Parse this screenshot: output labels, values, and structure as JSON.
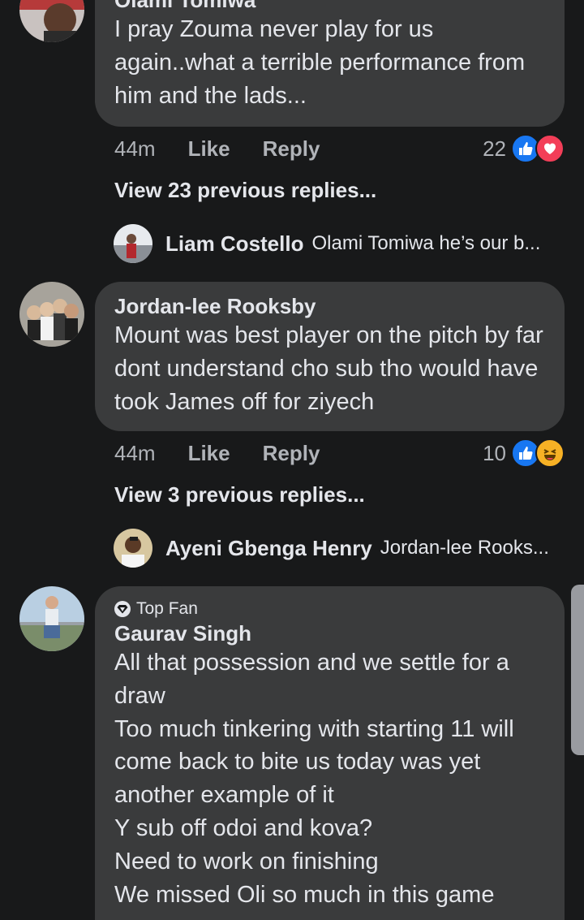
{
  "comments": [
    {
      "author": "Olami Tomiwa",
      "text": "I pray Zouma never play for us again..what a terrible performance from him and the lads...",
      "time": "44m",
      "like_label": "Like",
      "reply_label": "Reply",
      "reaction_count": "22",
      "reactions": [
        "like-icon",
        "love-icon"
      ],
      "view_previous": "View 23 previous replies...",
      "latest_reply": {
        "author": "Liam Costello",
        "text": "Olami Tomiwa  he’s our b..."
      }
    },
    {
      "author": "Jordan-lee Rooksby",
      "text": "Mount was best player on the pitch by far dont understand cho sub tho would have took James off for ziyech",
      "time": "44m",
      "like_label": "Like",
      "reply_label": "Reply",
      "reaction_count": "10",
      "reactions": [
        "like-icon",
        "haha-icon"
      ],
      "view_previous": "View 3 previous replies...",
      "latest_reply": {
        "author": "Ayeni Gbenga Henry",
        "text": "Jordan-lee Rooks..."
      }
    },
    {
      "badge": "Top Fan",
      "author": "Gaurav Singh",
      "text": "All that possession and we settle for a draw\nToo much tinkering with starting 11 will come back to bite us today was yet another example of it\nY sub off odoi and kova?\nNeed to work on finishing\nWe missed Oli so much in this game"
    }
  ],
  "colors": {
    "background": "#18191a",
    "bubble": "#3a3b3c",
    "secondary_text": "#b0b3b8",
    "like_blue": "#1877f2",
    "love_red": "#f33e58",
    "haha_yellow": "#f7b125"
  }
}
